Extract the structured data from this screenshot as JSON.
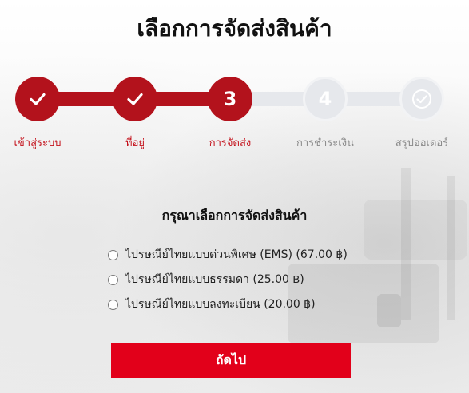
{
  "page": {
    "title": "เลือกการจัดส่งสินค้า"
  },
  "stepper": {
    "steps": [
      {
        "label": "เข้าสู่ระบบ",
        "status": "done",
        "icon": "check-icon"
      },
      {
        "label": "ที่อยู่",
        "status": "done",
        "icon": "check-icon"
      },
      {
        "label": "การจัดส่ง",
        "status": "current",
        "number": "3"
      },
      {
        "label": "การชำระเงิน",
        "status": "todo",
        "number": "4"
      },
      {
        "label": "สรุปออเดอร์",
        "status": "todo",
        "icon": "check-icon"
      }
    ]
  },
  "shipping": {
    "heading": "กรุณาเลือกการจัดส่งสินค้า",
    "options": [
      {
        "label": "ไปรษณีย์ไทยแบบด่วนพิเศษ (EMS) (67.00 ฿)",
        "selected": false
      },
      {
        "label": "ไปรษณีย์ไทยแบบธรรมดา (25.00 ฿)",
        "selected": false
      },
      {
        "label": "ไปรษณีย์ไทยแบบลงทะเบียน (20.00 ฿)",
        "selected": false
      }
    ]
  },
  "actions": {
    "next_label": "ถัดไป"
  },
  "colors": {
    "accent": "#b3121c",
    "button": "#e2001a",
    "inactive": "#e6e8ec"
  }
}
